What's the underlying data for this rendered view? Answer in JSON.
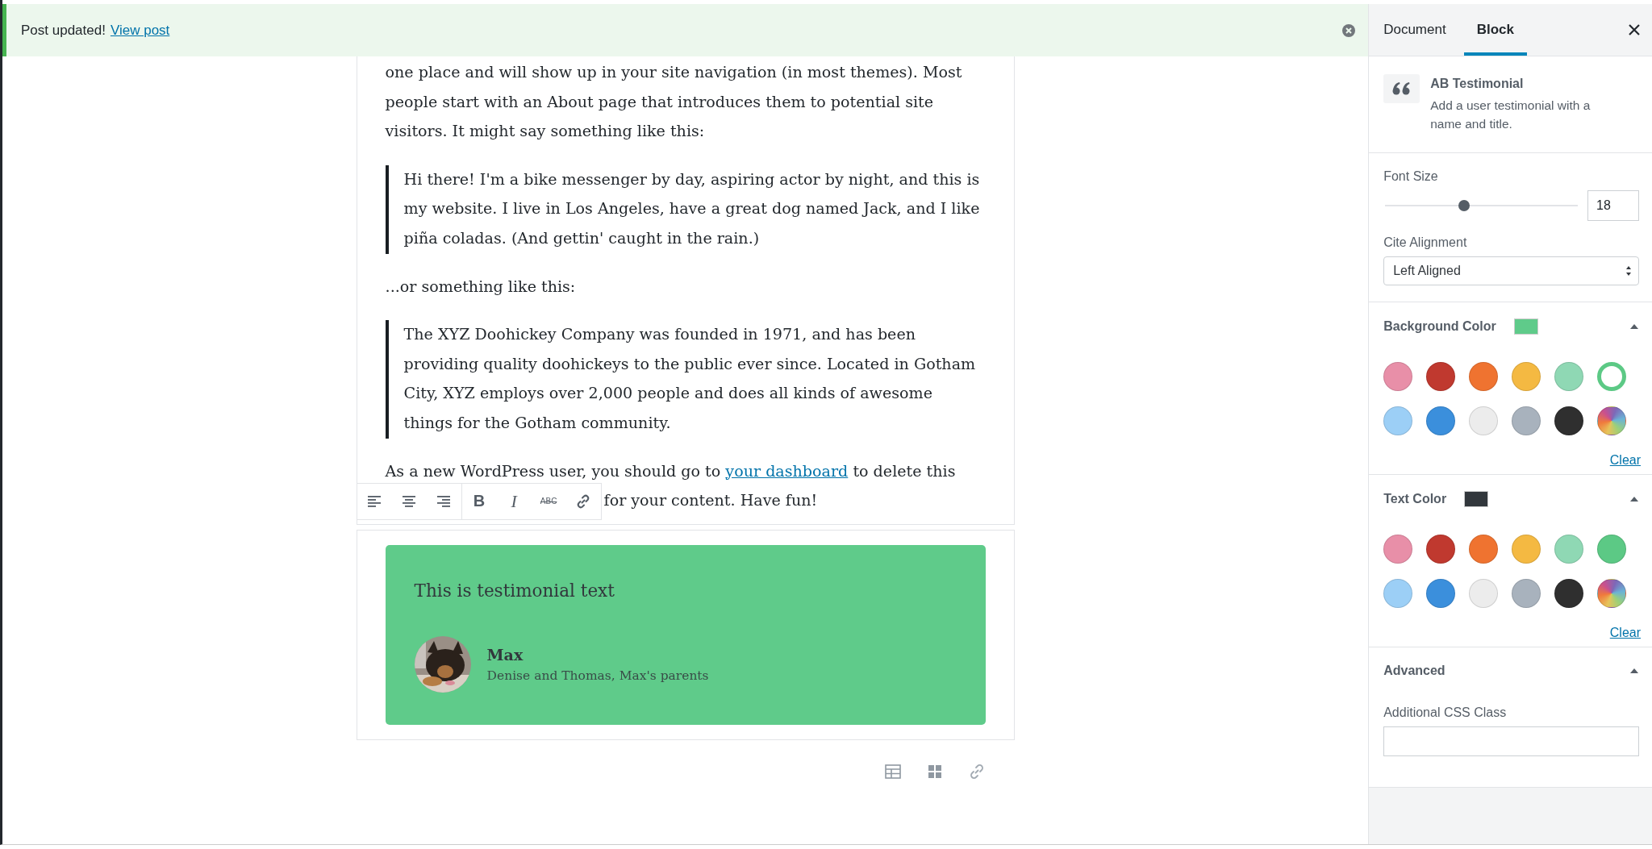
{
  "notice": {
    "message": "Post updated!",
    "link": "View post"
  },
  "content": [
    {
      "kind": "paragraph",
      "text": "one place and will show up in your site navigation (in most themes). Most people start with an About page that introduces them to potential site visitors. It might say something like this:"
    },
    {
      "kind": "quote",
      "text": "Hi there! I'm a bike messenger by day, aspiring actor by night, and this is my website. I live in Los Angeles, have a great dog named Jack, and I like piña coladas. (And gettin' caught in the rain.)"
    },
    {
      "kind": "paragraph",
      "text": "...or something like this:"
    },
    {
      "kind": "quote",
      "text": "The XYZ Doohickey Company was founded in 1971, and has been providing quality doohickeys to the public ever since. Located in Gotham City, XYZ employs over 2,000 people and does all kinds of awesome things for the Gotham community."
    },
    {
      "kind": "linked-paragraph",
      "before": "As a new WordPress user, you should go to",
      "link": "your dashboard",
      "after": "to delete this",
      "continuation": "for your content. Have fun!"
    }
  ],
  "block_toolbar": {
    "align_buttons": [
      {
        "kind": "left"
      },
      {
        "kind": "center"
      },
      {
        "kind": "right"
      }
    ],
    "format_buttons": [
      {
        "kind": "bold",
        "label": "B"
      },
      {
        "kind": "italic",
        "label": "I"
      },
      {
        "kind": "strikethrough",
        "label": "ABC"
      },
      {
        "kind": "link"
      }
    ]
  },
  "testimonial": {
    "text": "This is testimonial text",
    "name": "Max",
    "title": "Denise and Thomas, Max's parents"
  },
  "sidebar": {
    "tabs": [
      {
        "label": "Document",
        "selected": false
      },
      {
        "label": "Block",
        "selected": true
      }
    ],
    "block": {
      "title": "AB Testimonial",
      "description": "Add a user testimonial with a name and title."
    },
    "font_size": {
      "label": "Font Size",
      "level": 0.41,
      "value": "18"
    },
    "cite_alignment": {
      "label": "Cite Alignment",
      "value": "Left Aligned"
    },
    "color_panels": [
      {
        "title": "Background Color",
        "color": "#5fcb8a",
        "expanded": true,
        "clear": "Clear",
        "swatches": [
          {
            "color": "#e88fa8",
            "selected": false
          },
          {
            "color": "#c0392f",
            "selected": false
          },
          {
            "color": "#ef7330",
            "selected": false
          },
          {
            "color": "#f4b942",
            "selected": false
          },
          {
            "color": "#8fd8b4",
            "selected": false
          },
          {
            "color": "#5cc985",
            "selected": true
          },
          {
            "color": "#9ccff6",
            "selected": false
          },
          {
            "color": "#3b8fdc",
            "selected": false
          },
          {
            "color": "#ececec",
            "selected": false
          },
          {
            "color": "#a8b2bd",
            "selected": false
          },
          {
            "color": "#2f2f2f",
            "selected": false
          },
          {
            "kind": "custom",
            "selected": false
          }
        ]
      },
      {
        "title": "Text Color",
        "color": "#32373c",
        "expanded": true,
        "clear": "Clear",
        "swatches": [
          {
            "color": "#e88fa8",
            "selected": false
          },
          {
            "color": "#c0392f",
            "selected": false
          },
          {
            "color": "#ef7330",
            "selected": false
          },
          {
            "color": "#f4b942",
            "selected": false
          },
          {
            "color": "#8fd8b4",
            "selected": false
          },
          {
            "color": "#5cc985",
            "selected": false
          },
          {
            "color": "#9ccff6",
            "selected": false
          },
          {
            "color": "#3b8fdc",
            "selected": false
          },
          {
            "color": "#ececec",
            "selected": false
          },
          {
            "color": "#a8b2bd",
            "selected": false
          },
          {
            "color": "#2f2f2f",
            "selected": false
          },
          {
            "kind": "custom",
            "selected": false
          }
        ]
      }
    ],
    "advanced": {
      "title": "Advanced",
      "expanded": true,
      "field_label": "Additional CSS Class"
    }
  }
}
